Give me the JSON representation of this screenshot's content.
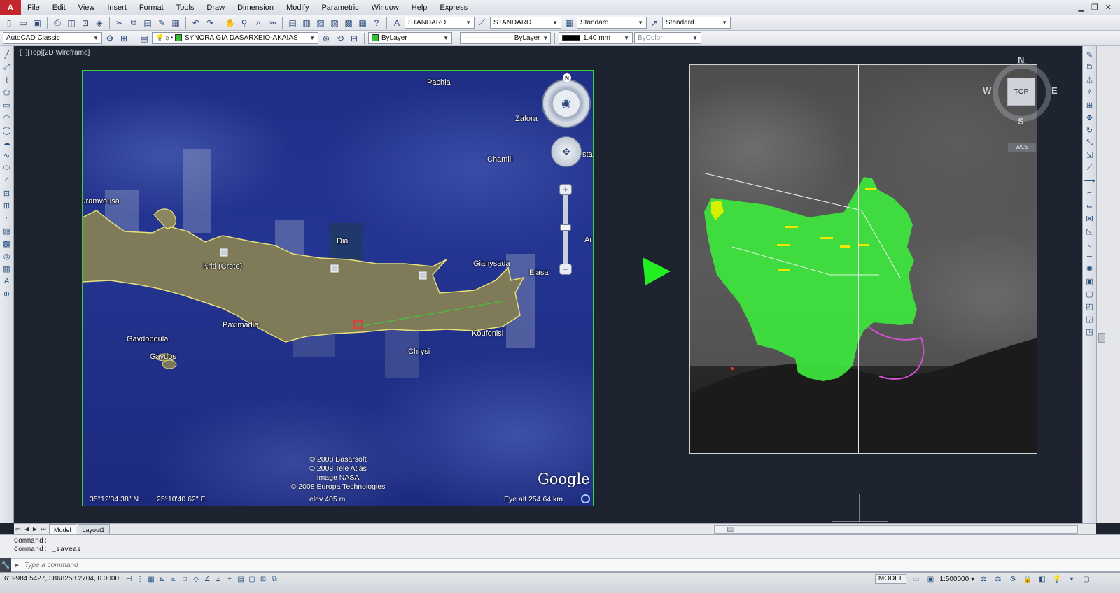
{
  "menubar": {
    "items": [
      "File",
      "Edit",
      "View",
      "Insert",
      "Format",
      "Tools",
      "Draw",
      "Dimension",
      "Modify",
      "Parametric",
      "Window",
      "Help",
      "Express"
    ]
  },
  "toolbar1": {
    "text_style": "STANDARD",
    "dim_style": "STANDARD",
    "table_style": "Standard",
    "multileader_style": "Standard"
  },
  "toolbar2": {
    "workspace": "AutoCAD Classic",
    "layer": "SYNORA GIA DASARXEIO-AKAIAS",
    "color": "ByLayer",
    "linetype": "ByLayer",
    "lineweight": "1.40 mm",
    "plotstyle": "ByColor",
    "colors": {
      "layer_swatch": "#2fbf2f",
      "color_swatch": "#2fbf2f",
      "lineweight_swatch": "#000000"
    }
  },
  "viewport": {
    "label": "[−][Top][2D Wireframe]"
  },
  "google_map": {
    "labels": [
      "Pachia",
      "Zafora",
      "Chamili",
      "Gramvousa",
      "Dia",
      "Kriti (Crete)",
      "Gianysada",
      "Elasa",
      "Paximadia",
      "Gavdopoula",
      "Gavdos",
      "Chrysi",
      "Koufonisi",
      "sta",
      "Ar"
    ],
    "copyright": [
      "© 2008 Basarsoft",
      "© 2008 Tele Atlas",
      "Image NASA",
      "© 2008 Europa Technologies"
    ],
    "logo": "Google",
    "latitude": "35°12'34.38\" N",
    "longitude": "25°10'40.62\" E",
    "elevation": "elev  405 m",
    "eye_alt": "Eye alt   254.64 km",
    "compass_n": "N"
  },
  "viewcube": {
    "n": "N",
    "s": "S",
    "e": "E",
    "w": "W",
    "top": "TOP",
    "wcs": "WCS"
  },
  "layout_tabs": [
    "Model",
    "Layout1"
  ],
  "command": {
    "history": [
      "Command:",
      "Command: _saveas"
    ],
    "placeholder": "Type a command"
  },
  "statusbar": {
    "coordinates": "619984.5427, 3868258.2704, 0.0000",
    "model": "MODEL",
    "scale": "1:500000"
  },
  "colors": {
    "accent_green": "#2fd22f",
    "ge_border": "#3ccf3c",
    "boundary_fill": "#3de63d",
    "arrow": "#22ee22"
  }
}
